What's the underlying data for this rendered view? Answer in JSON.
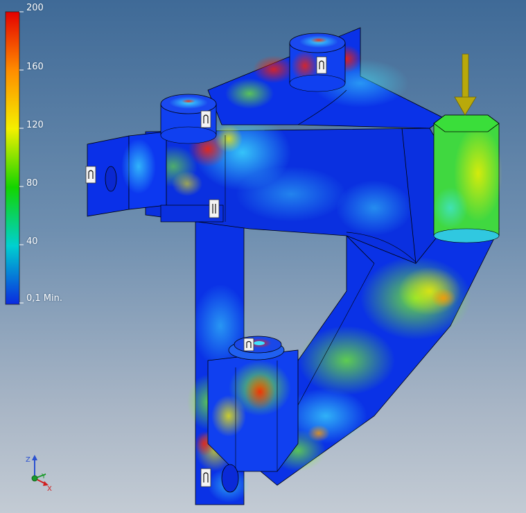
{
  "viewer": {
    "name": "stress-analysis-viewport",
    "background_top": "#3f6a97",
    "background_bottom": "#c3cbd4"
  },
  "legend": {
    "labels": [
      "200",
      "160",
      "120",
      "80",
      "40",
      "0,1 Min."
    ],
    "gradient_colors": [
      "#e40000",
      "#ff8c00",
      "#f4f000",
      "#13d400",
      "#00d0d0",
      "#0a2ae0"
    ]
  },
  "load_arrow": {
    "color": "#b9a90a",
    "icon": "down-arrow-icon"
  },
  "constraint_icons": [
    "pin-icon",
    "pin-icon",
    "pin-icon",
    "pin-icon",
    "pin-icon",
    "pin-icon"
  ],
  "triad": {
    "z_label": "Z",
    "y_label": "Y",
    "x_label": "X",
    "z_color": "#2a50d0",
    "y_color": "#1a9a2a",
    "x_color": "#d02020"
  }
}
